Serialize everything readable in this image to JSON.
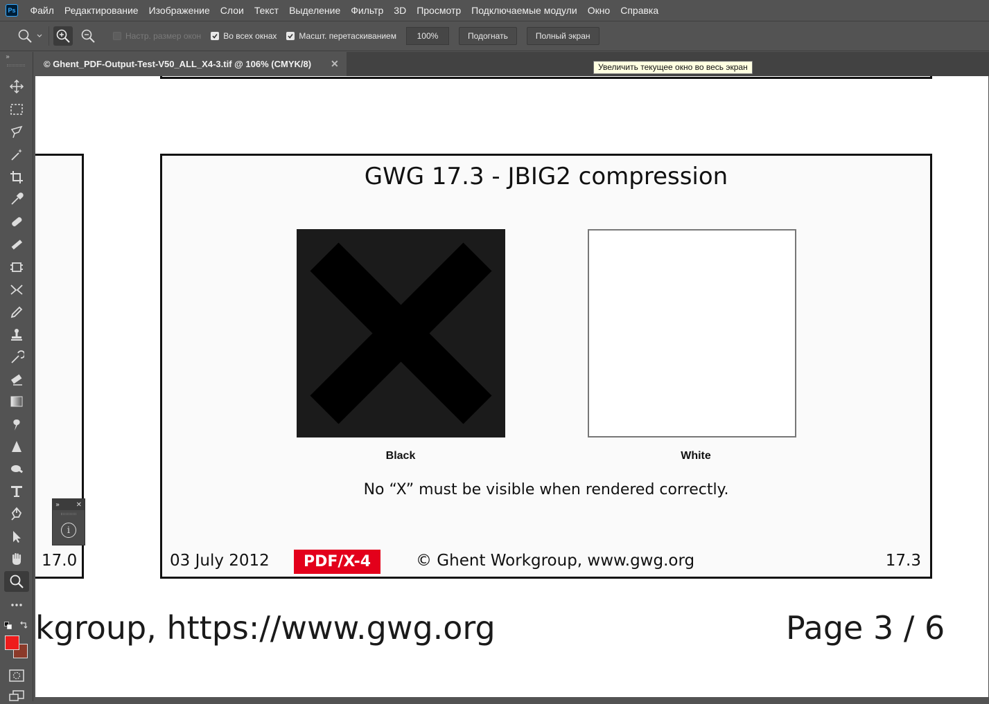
{
  "app": {
    "logo": "Ps"
  },
  "menu": [
    "Файл",
    "Редактирование",
    "Изображение",
    "Слои",
    "Текст",
    "Выделение",
    "Фильтр",
    "3D",
    "Просмотр",
    "Подключаемые модули",
    "Окно",
    "Справка"
  ],
  "options": {
    "resize_windows_label": "Настр. размер окон",
    "resize_windows_checked": false,
    "all_windows_label": "Во всех окнах",
    "all_windows_checked": true,
    "scrubby_zoom_label": "Масшт. перетаскиванием",
    "scrubby_zoom_checked": true,
    "zoom_value": "100%",
    "fit_button": "Подогнать",
    "fullscreen_button": "Полный экран"
  },
  "tooltip": "Увеличить текущее окно во весь экран",
  "document": {
    "tab_title": "© Ghent_PDF-Output-Test-V50_ALL_X4-3.tif @ 106% (CMYK/8)",
    "slide_title": "GWG 17.3 - JBIG2 compression",
    "caption_black": "Black",
    "caption_white": "White",
    "note": "No “X” must be visible when rendered correctly.",
    "date": "03 July 2012",
    "badge": "PDF/X-4",
    "copyright": "© Ghent Workgroup, www.gwg.org",
    "slide_number": "17.3",
    "prev_slide_number": "17.0",
    "page_footer_left": "kgroup, https://www.gwg.org",
    "page_footer_right": "Page 3 / 6"
  },
  "colors": {
    "foreground": "#ee1c1c",
    "background": "#8b3a2a",
    "badge": "#e3001b"
  },
  "tools": [
    "move-tool",
    "marquee-tool",
    "lasso-tool",
    "magic-wand-tool",
    "crop-tool",
    "eyedropper-tool",
    "spot-healing-tool",
    "brush-tool",
    "frame-tool",
    "content-aware-move-tool",
    "pencil-tool",
    "clone-stamp-tool",
    "history-brush-tool",
    "eraser-tool",
    "gradient-tool",
    "smudge-tool",
    "sharpen-tool",
    "dodge-tool",
    "type-tool",
    "pen-tool",
    "path-selection-tool",
    "hand-tool",
    "zoom-tool",
    "more-tools"
  ]
}
